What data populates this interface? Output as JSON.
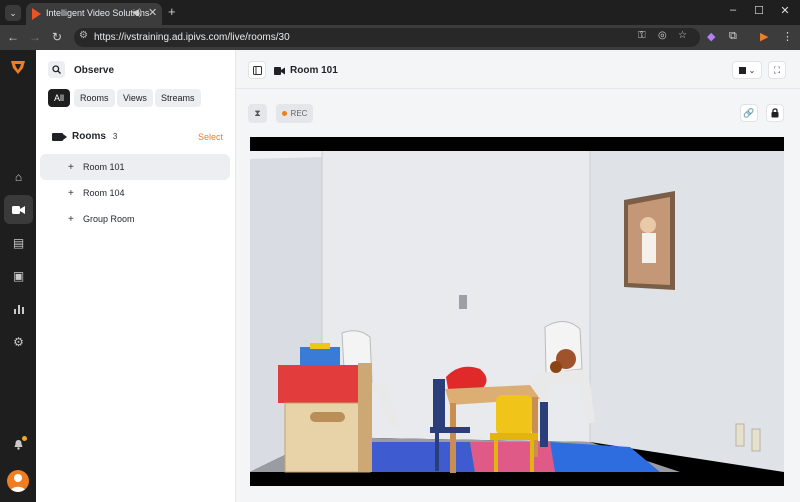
{
  "browser": {
    "tab_title": "Intelligent Video Solutions",
    "url": "https://ivstraining.ad.ipivs.com/live/rooms/30"
  },
  "sidebar": {
    "title": "Observe",
    "filters": [
      {
        "label": "All",
        "active": true
      },
      {
        "label": "Rooms",
        "active": false
      },
      {
        "label": "Views",
        "active": false
      },
      {
        "label": "Streams",
        "active": false
      }
    ],
    "section_title": "Rooms",
    "section_count": "3",
    "select_label": "Select",
    "rooms": [
      {
        "label": "Room 101",
        "active": true
      },
      {
        "label": "Room 104",
        "active": false
      },
      {
        "label": "Group Room",
        "active": false
      }
    ]
  },
  "main": {
    "title": "Room 101",
    "rec_label": "REC"
  },
  "colors": {
    "accent": "#ef7d22",
    "rail": "#1e1e1e"
  }
}
